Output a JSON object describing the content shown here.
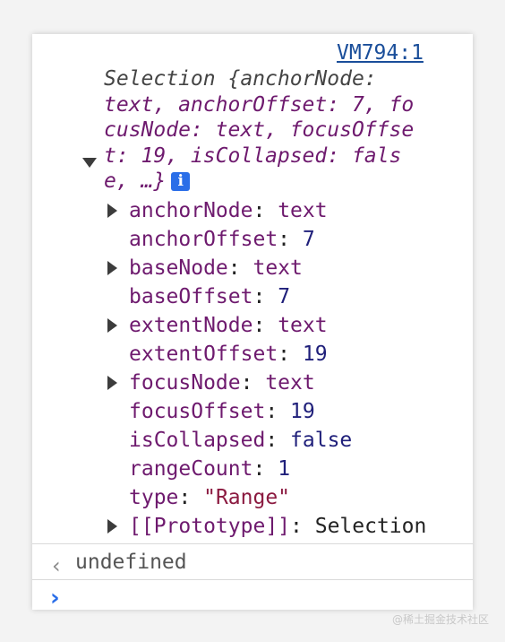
{
  "source_link": "VM794:1",
  "summary": {
    "line1": "Selection {anchorNode:",
    "line2_key": "text, anchorOffset: 7, fo",
    "line3": "cusNode: text, focusOffse",
    "line4": "t: 19, isCollapsed: fals",
    "line5": "e, …}",
    "info_icon": "i"
  },
  "properties": [
    {
      "key": "anchorNode",
      "value": "text",
      "type": "obj",
      "expandable": true
    },
    {
      "key": "anchorOffset",
      "value": "7",
      "type": "num",
      "expandable": false
    },
    {
      "key": "baseNode",
      "value": "text",
      "type": "obj",
      "expandable": true
    },
    {
      "key": "baseOffset",
      "value": "7",
      "type": "num",
      "expandable": false
    },
    {
      "key": "extentNode",
      "value": "text",
      "type": "obj",
      "expandable": true
    },
    {
      "key": "extentOffset",
      "value": "19",
      "type": "num",
      "expandable": false
    },
    {
      "key": "focusNode",
      "value": "text",
      "type": "obj",
      "expandable": true
    },
    {
      "key": "focusOffset",
      "value": "19",
      "type": "num",
      "expandable": false
    },
    {
      "key": "isCollapsed",
      "value": "false",
      "type": "kw",
      "expandable": false
    },
    {
      "key": "rangeCount",
      "value": "1",
      "type": "num",
      "expandable": false
    },
    {
      "key": "type",
      "value": "\"Range\"",
      "type": "str",
      "expandable": false
    },
    {
      "key": "[[Prototype]]",
      "value": "Selection",
      "type": "plain",
      "expandable": true
    }
  ],
  "return_value": "undefined",
  "watermark": "@稀土掘金技术社区"
}
